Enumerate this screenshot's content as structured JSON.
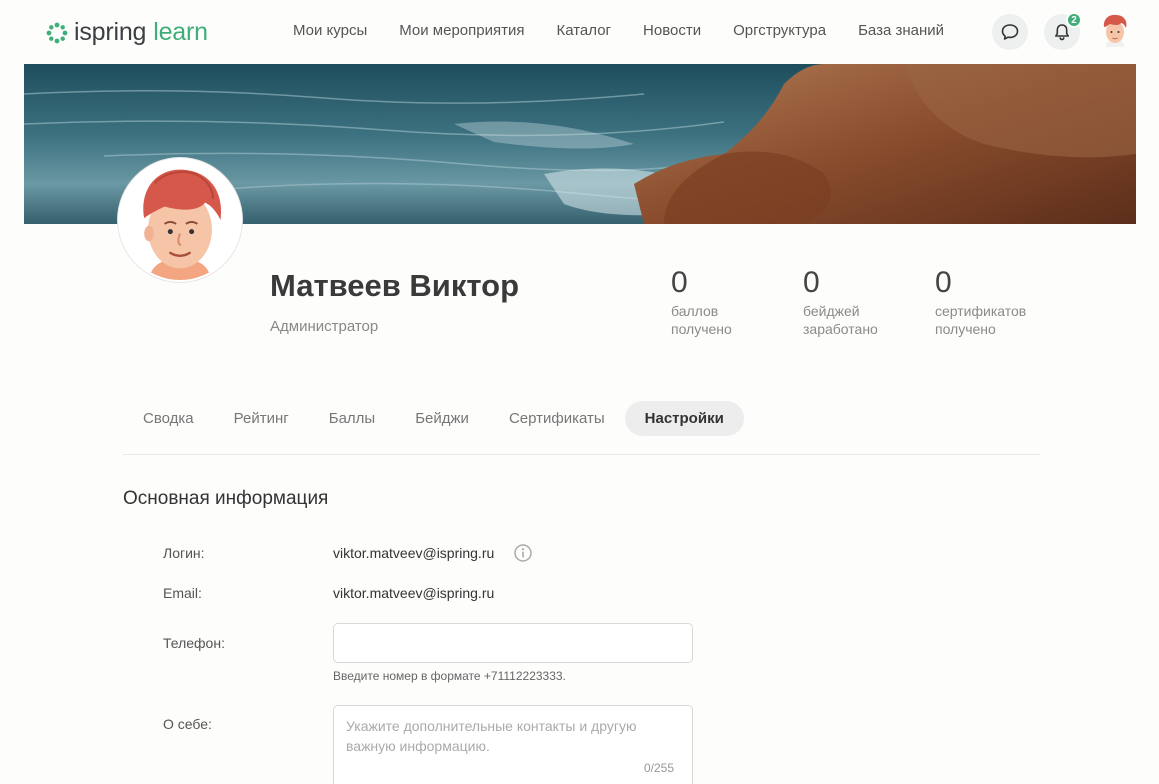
{
  "header": {
    "logo_part1": "ispring",
    "logo_part2": "learn",
    "nav": [
      "Мои курсы",
      "Мои мероприятия",
      "Каталог",
      "Новости",
      "Оргструктура",
      "База знаний"
    ],
    "notifications_count": "2",
    "icons": [
      "chat-icon",
      "bell-icon",
      "avatar"
    ]
  },
  "profile": {
    "name": "Матвеев Виктор",
    "role": "Администратор",
    "stats": [
      {
        "value": "0",
        "label_line1": "баллов",
        "label_line2": "получено"
      },
      {
        "value": "0",
        "label_line1": "бейджей",
        "label_line2": "заработано"
      },
      {
        "value": "0",
        "label_line1": "сертификатов",
        "label_line2": "получено"
      }
    ]
  },
  "tabs": [
    "Сводка",
    "Рейтинг",
    "Баллы",
    "Бейджи",
    "Сертификаты",
    "Настройки"
  ],
  "active_tab": "Настройки",
  "form": {
    "section_title": "Основная информация",
    "login_label": "Логин:",
    "login_value": "viktor.matveev@ispring.ru",
    "email_label": "Email:",
    "email_value": "viktor.matveev@ispring.ru",
    "phone_label": "Телефон:",
    "phone_value": "",
    "phone_hint": "Введите номер в формате +71112223333.",
    "about_label": "О себе:",
    "about_placeholder": "Укажите дополнительные контакты и другую важную информацию.",
    "about_counter": "0/255"
  },
  "colors": {
    "brand_green": "#3fae78",
    "text_dark": "#333333",
    "tab_active_bg": "#ededed"
  }
}
